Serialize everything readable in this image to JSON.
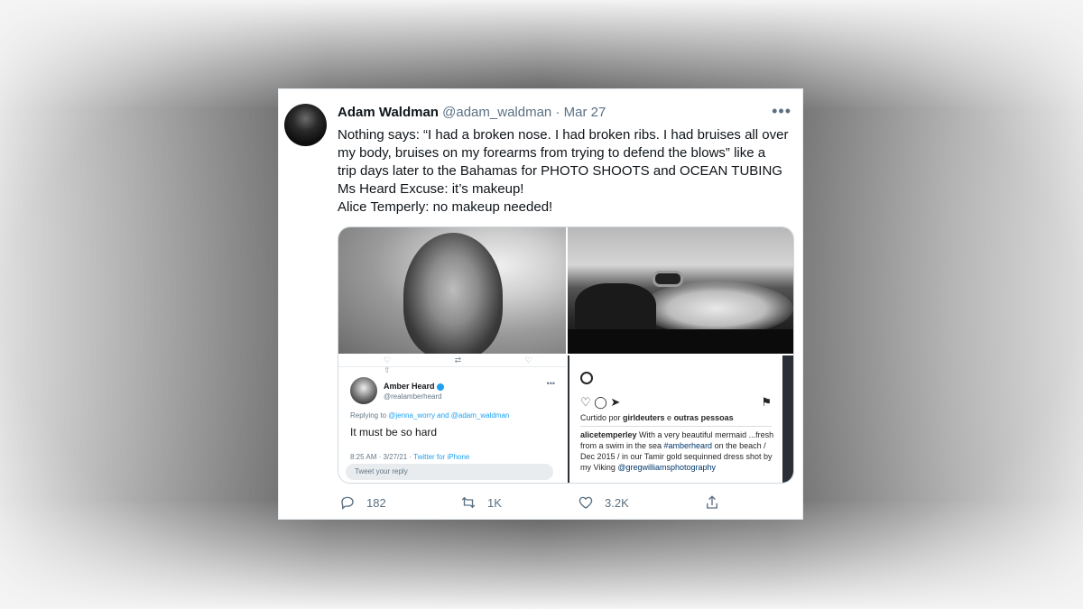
{
  "tweet": {
    "author_name": "Adam Waldman",
    "author_handle": "@adam_waldman",
    "separator": "·",
    "date": "Mar 27",
    "more_label": "•••",
    "text_lines": [
      "Nothing says: “I had a broken nose. I had broken ribs. I had bruises all over",
      "my body, bruises on my forearms from trying to defend the blows” like a",
      "trip days later to the Bahamas for PHOTO SHOOTS and OCEAN TUBING",
      "Ms Heard Excuse: it’s makeup!",
      "Alice Temperly: no makeup needed!"
    ]
  },
  "embedded_tweet": {
    "author_name": "Amber Heard",
    "author_handle": "@realamberheard",
    "dots": "•••",
    "replying_prefix": "Replying to ",
    "replying_to": "@jenna_worry and @adam_waldman",
    "text": "It must be so hard",
    "meta_time": "8:25 AM · 3/27/21 · ",
    "meta_source": "Twitter for iPhone",
    "reply_placeholder": "Tweet your reply"
  },
  "instagram": {
    "liked_prefix": "Curtido por ",
    "liked_user": "girldeuters",
    "liked_suffix": " e ",
    "liked_others": "outras pessoas",
    "caption_user": "alicetemperley",
    "caption_1": " With a very beautiful mermaid ...fresh from a swim in the sea ",
    "caption_tag1": "#amberheard",
    "caption_2": " on the beach / Dec 2015 / in our Tamir  gold sequinned dress  shot by my Viking  ",
    "caption_tag2": "@gregwilliamsphotography"
  },
  "metrics": {
    "replies": "182",
    "retweets": "1K",
    "likes": "3.2K"
  },
  "icons": {
    "reply": "reply-icon",
    "retweet": "retweet-icon",
    "like": "heart-icon",
    "share": "share-icon"
  }
}
